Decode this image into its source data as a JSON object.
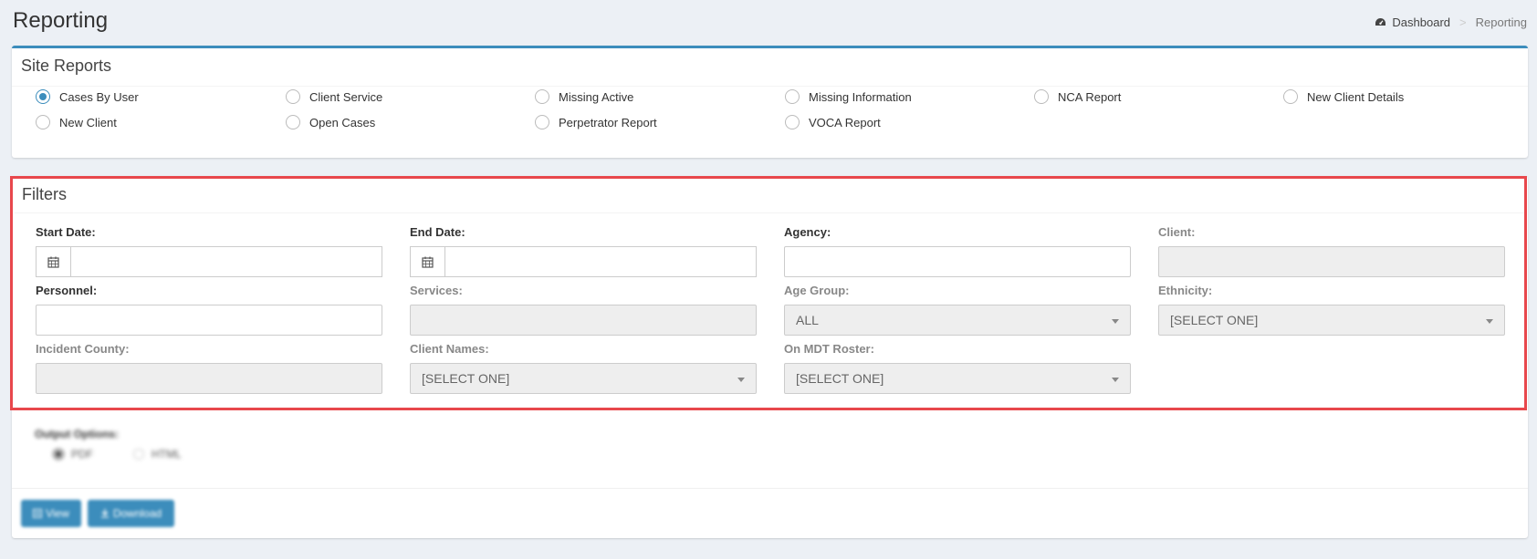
{
  "header": {
    "title": "Reporting",
    "breadcrumb": {
      "home_label": "Dashboard",
      "separator": ">",
      "current": "Reporting"
    }
  },
  "site_reports": {
    "title": "Site Reports",
    "options": [
      {
        "label": "Cases By User",
        "checked": true
      },
      {
        "label": "Client Service",
        "checked": false
      },
      {
        "label": "Missing Active",
        "checked": false
      },
      {
        "label": "Missing Information",
        "checked": false
      },
      {
        "label": "NCA Report",
        "checked": false
      },
      {
        "label": "New Client Details",
        "checked": false
      },
      {
        "label": "New Client",
        "checked": false
      },
      {
        "label": "Open Cases",
        "checked": false
      },
      {
        "label": "Perpetrator Report",
        "checked": false
      },
      {
        "label": "VOCA Report",
        "checked": false
      }
    ]
  },
  "filters": {
    "title": "Filters",
    "start_date": {
      "label": "Start Date:",
      "value": ""
    },
    "end_date": {
      "label": "End Date:",
      "value": ""
    },
    "agency": {
      "label": "Agency:",
      "value": ""
    },
    "client": {
      "label": "Client:",
      "value": ""
    },
    "personnel": {
      "label": "Personnel:",
      "value": ""
    },
    "services": {
      "label": "Services:",
      "value": ""
    },
    "age_group": {
      "label": "Age Group:",
      "value": "ALL"
    },
    "ethnicity": {
      "label": "Ethnicity:",
      "value": "[SELECT ONE]"
    },
    "incident_county": {
      "label": "Incident County:",
      "value": ""
    },
    "client_names": {
      "label": "Client Names:",
      "value": "[SELECT ONE]"
    },
    "on_mdt_roster": {
      "label": "On MDT Roster:",
      "value": "[SELECT ONE]"
    }
  },
  "output": {
    "label": "Output Options:",
    "options": [
      {
        "label": "PDF",
        "checked": true
      },
      {
        "label": "HTML",
        "checked": false
      }
    ]
  },
  "actions": {
    "view_label": "View",
    "download_label": "Download"
  },
  "colors": {
    "accent": "#3c8dbc",
    "highlight": "#e8474c",
    "background": "#ecf0f5"
  },
  "icons": {
    "breadcrumb_home": "dashboard-icon",
    "date_addon": "calendar-icon",
    "view_button": "list-icon",
    "download_button": "download-icon"
  }
}
